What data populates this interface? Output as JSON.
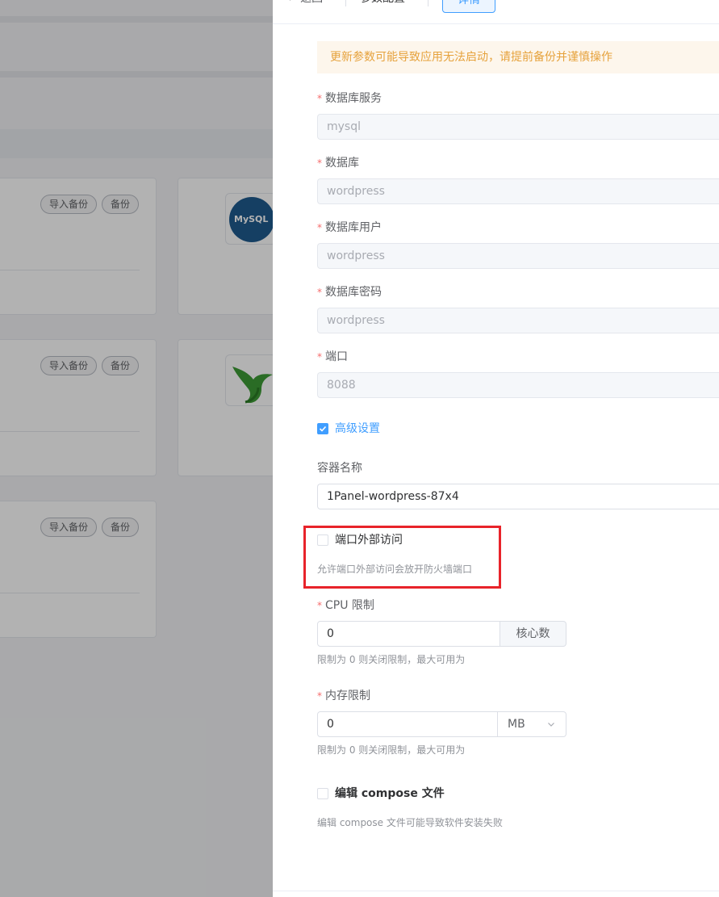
{
  "background": {
    "cards": [
      {
        "tags": [
          "导入备份",
          "备份"
        ]
      },
      {
        "tags": [
          "导入备份",
          "备份"
        ]
      },
      {
        "tags": [
          "导入备份",
          "备份"
        ]
      }
    ],
    "mysql_icon_text": "MySQL"
  },
  "drawer": {
    "back_label": "返回",
    "title": "参数配置",
    "active_tab": "详情",
    "warning": "更新参数可能导致应用无法启动，请提前备份并谨慎操作",
    "fields": {
      "db_service": {
        "label": "数据库服务",
        "value": "mysql"
      },
      "database": {
        "label": "数据库",
        "value": "wordpress"
      },
      "db_user": {
        "label": "数据库用户",
        "value": "wordpress"
      },
      "db_password": {
        "label": "数据库密码",
        "value": "wordpress"
      },
      "port": {
        "label": "端口",
        "value": "8088"
      }
    },
    "advanced": {
      "label": "高级设置",
      "checked": true
    },
    "container_name": {
      "label": "容器名称",
      "value": "1Panel-wordpress-87x4"
    },
    "port_external": {
      "label": "端口外部访问",
      "checked": false,
      "hint": "允许端口外部访问会放开防火墙端口"
    },
    "cpu": {
      "label": "CPU 限制",
      "value": "0",
      "unit": "核心数",
      "hint": "限制为 0 则关闭限制，最大可用为"
    },
    "memory": {
      "label": "内存限制",
      "value": "0",
      "unit": "MB",
      "hint": "限制为 0 则关闭限制，最大可用为"
    },
    "edit_compose": {
      "label": "编辑 compose 文件",
      "checked": false,
      "hint": "编辑 compose 文件可能导致软件安装失败"
    }
  }
}
